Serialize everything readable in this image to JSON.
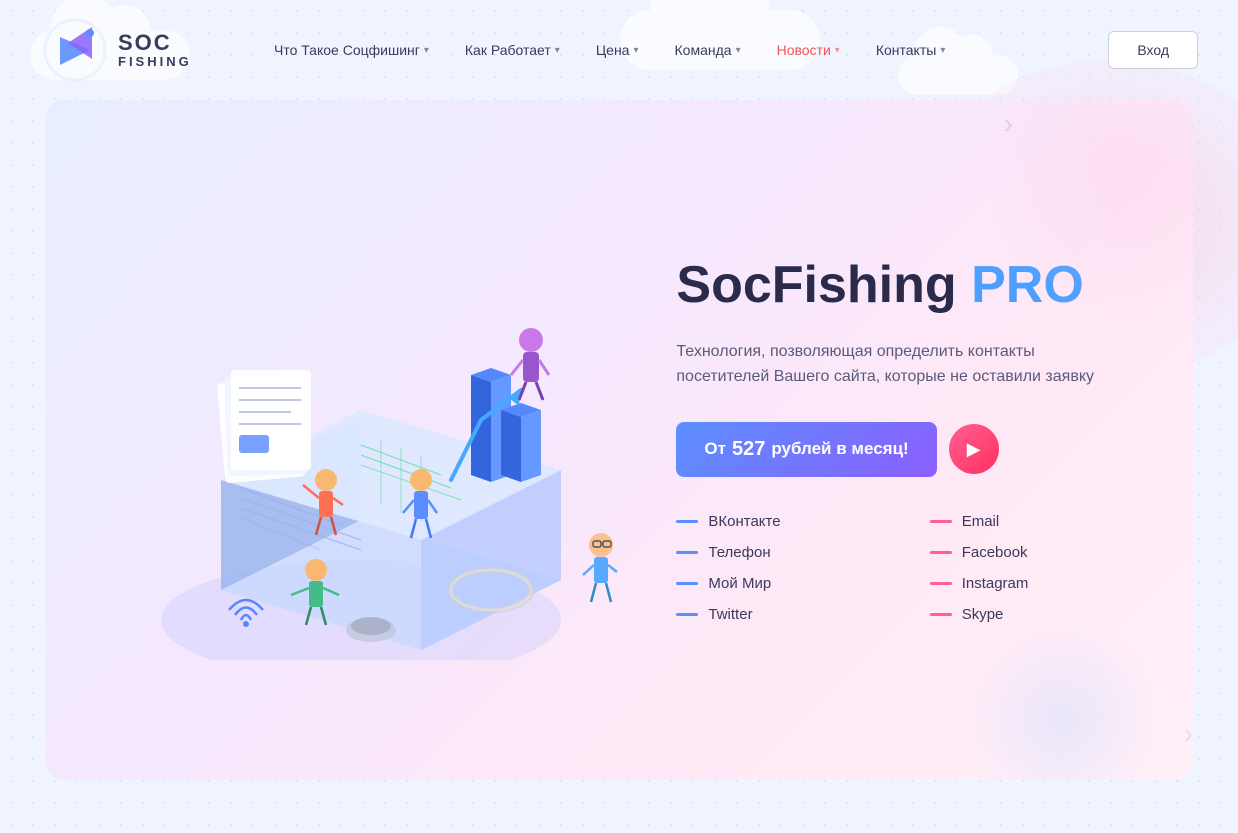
{
  "logo": {
    "soc_label": "SOC",
    "fishing_label": "FISHING",
    "dot": "®"
  },
  "nav": {
    "items": [
      {
        "label": "Что Такое Соцфишинг",
        "id": "what",
        "active": false
      },
      {
        "label": "Как Работает",
        "id": "how",
        "active": false
      },
      {
        "label": "Цена",
        "id": "price",
        "active": false
      },
      {
        "label": "Команда",
        "id": "team",
        "active": false
      },
      {
        "label": "Новости",
        "id": "news",
        "active": true
      },
      {
        "label": "Контакты",
        "id": "contacts",
        "active": false
      }
    ],
    "login_label": "Вход"
  },
  "hero": {
    "title_main": "SocFishing ",
    "title_pro": "PRO",
    "subtitle": "Технология, позволяющая определить контакты посетителей Вашего сайта, которые не оставили заявку",
    "cta_prefix": "От ",
    "cta_price": "527",
    "cta_suffix": " рублей в месяц!",
    "play_icon": "▶"
  },
  "contacts": {
    "left": [
      {
        "label": "ВКонтакте",
        "color": "blue"
      },
      {
        "label": "Телефон",
        "color": "blue"
      },
      {
        "label": "Мой Мир",
        "color": "blue"
      },
      {
        "label": "Twitter",
        "color": "blue"
      }
    ],
    "right": [
      {
        "label": "Email",
        "color": "pink"
      },
      {
        "label": "Facebook",
        "color": "pink"
      },
      {
        "label": "Instagram",
        "color": "pink"
      },
      {
        "label": "Skype",
        "color": "pink"
      }
    ]
  }
}
